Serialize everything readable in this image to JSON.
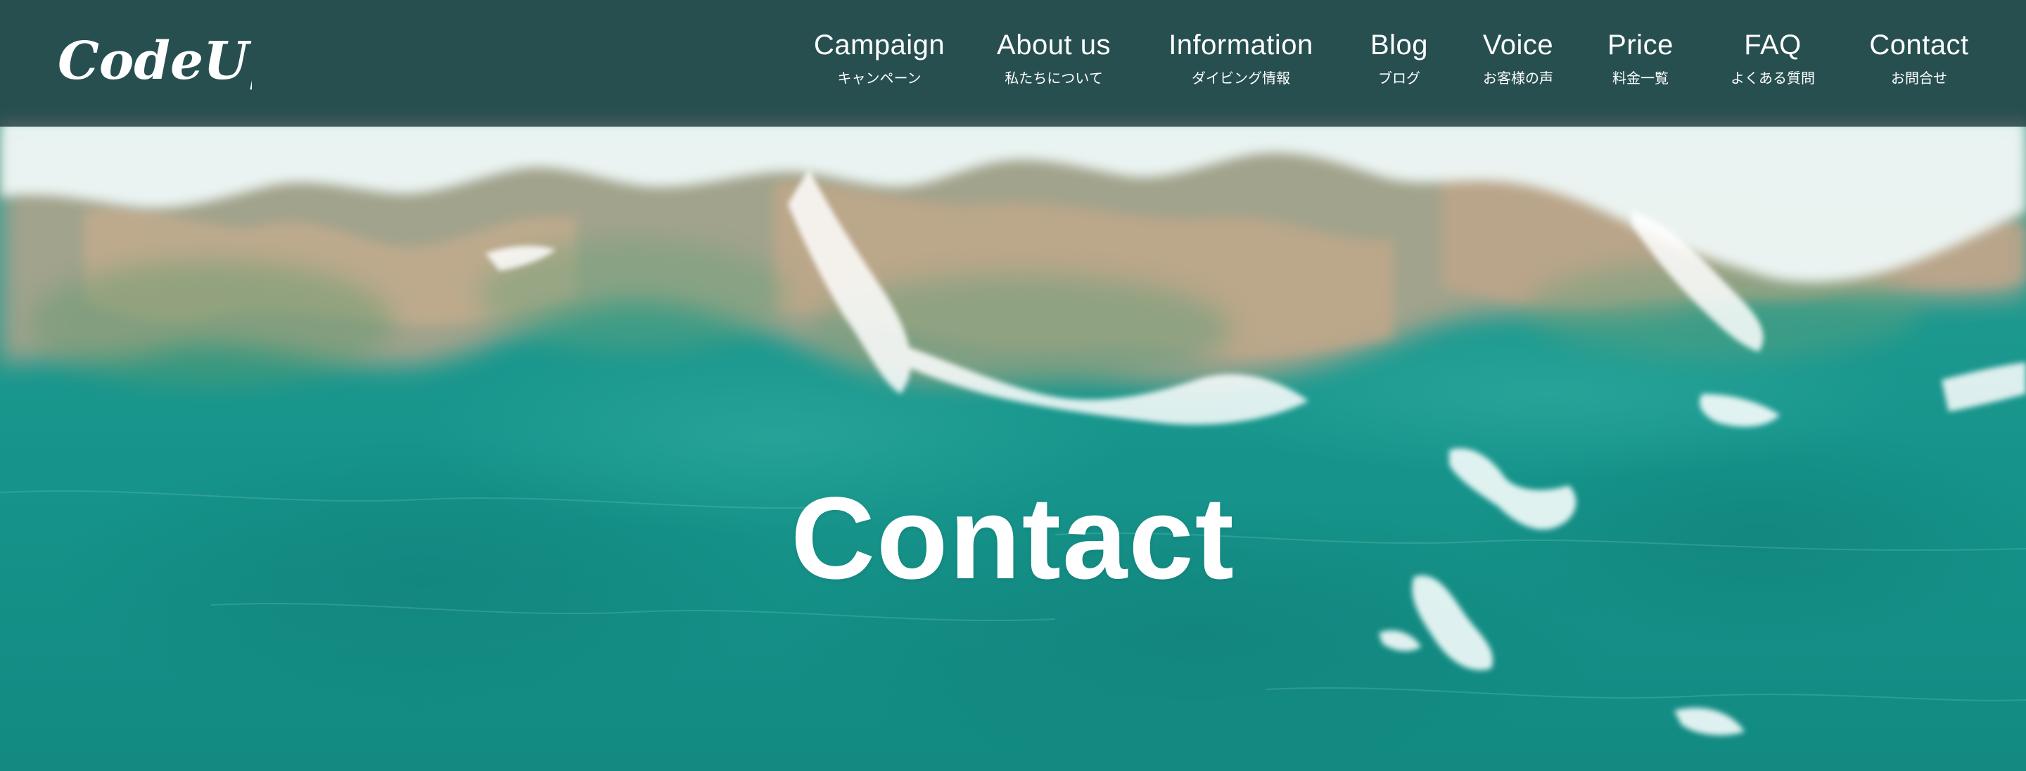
{
  "brand": {
    "logo_text": "CodeUps"
  },
  "nav": {
    "items": [
      {
        "en": "Campaign",
        "ja": "キャンペーン"
      },
      {
        "en": "About us",
        "ja": "私たちについて"
      },
      {
        "en": "Information",
        "ja": "ダイビング情報"
      },
      {
        "en": "Blog",
        "ja": "ブログ"
      },
      {
        "en": "Voice",
        "ja": "お客様の声"
      },
      {
        "en": "Price",
        "ja": "料金一覧"
      },
      {
        "en": "FAQ",
        "ja": "よくある質問"
      },
      {
        "en": "Contact",
        "ja": "お問合せ"
      }
    ]
  },
  "hero": {
    "title": "Contact"
  },
  "colors": {
    "header_bg": "#2a4548",
    "ocean_deep": "#178e86",
    "ocean_mid": "#23a59b",
    "sand": "#c7a98e",
    "foam": "#f4fbfa",
    "text": "#ffffff"
  }
}
